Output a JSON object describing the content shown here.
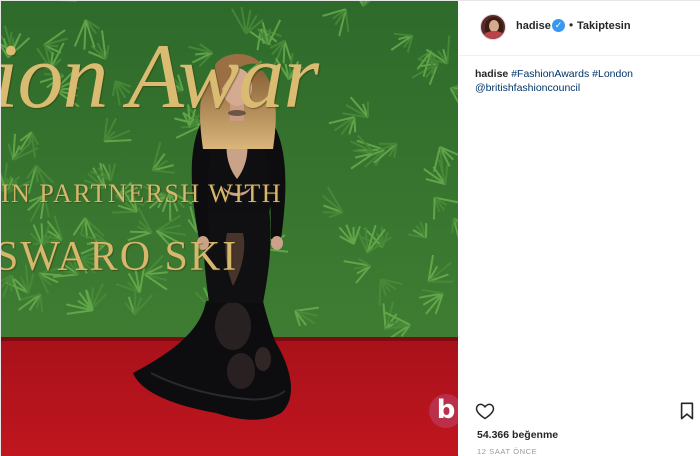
{
  "post": {
    "header": {
      "username": "hadise",
      "separator": "•",
      "follow_status": "Takiptesin"
    },
    "photo": {
      "backdrop_script_text": "ion Awar",
      "backdrop_partners_text": "IN PARTNERSH  WITH",
      "backdrop_sponsor_text": "SWARO SKI",
      "watermark_letter": "b"
    },
    "caption": {
      "username": "hadise",
      "hashtags": [
        "#FashionAwards",
        "#London"
      ],
      "mention": "@britishfashioncouncil"
    },
    "likes_text": "54.366 beğenme",
    "timestamp": "12 SAAT ÖNCE",
    "icons": {
      "like": "heart-icon",
      "save": "bookmark-icon",
      "verified": "verified-badge-icon"
    },
    "colors": {
      "verified_blue": "#3897f0",
      "hashtag_blue": "#003569",
      "carpet_red": "#b5121b",
      "foliage_green": "#2f6b2a",
      "gold_lettering": "#d6b76d"
    }
  }
}
